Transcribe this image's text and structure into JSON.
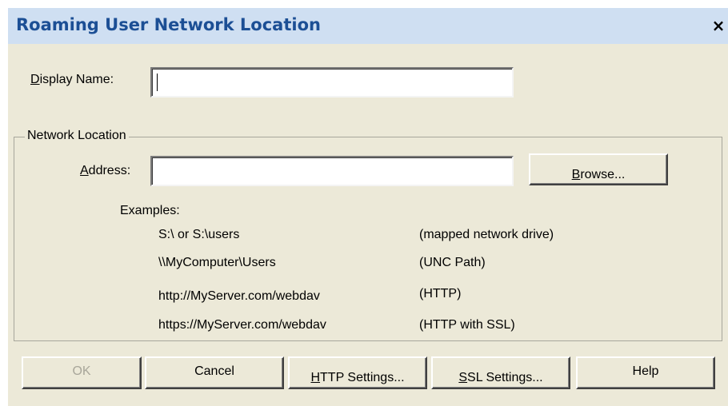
{
  "window": {
    "title": "Roaming User Network Location",
    "close_glyph": "×"
  },
  "form": {
    "display_name_label_key": "D",
    "display_name_label_rest": "isplay Name:",
    "display_name_value": ""
  },
  "network_location": {
    "group_title": "Network Location",
    "address_label_key": "A",
    "address_label_rest": "ddress:",
    "address_value": "",
    "browse_key": "B",
    "browse_rest": "rowse...",
    "examples_label": "Examples:",
    "examples": [
      {
        "path": "S:\\ or S:\\users",
        "desc": "(mapped network drive)"
      },
      {
        "path": "\\\\MyComputer\\Users",
        "desc": "(UNC Path)"
      },
      {
        "path": "http://MyServer.com/webdav",
        "desc": "(HTTP)"
      },
      {
        "path": "https://MyServer.com/webdav",
        "desc": "(HTTP with SSL)"
      }
    ]
  },
  "buttons": {
    "ok": "OK",
    "cancel": "Cancel",
    "http_key": "H",
    "http_rest": "TTP Settings...",
    "ssl_key": "S",
    "ssl_rest": "SL Settings...",
    "help": "Help"
  },
  "colors": {
    "title_bg": "#cfdff2",
    "title_text": "#1c4f95",
    "dialog_bg": "#ece9d8",
    "disabled_text": "#a8a69a"
  }
}
